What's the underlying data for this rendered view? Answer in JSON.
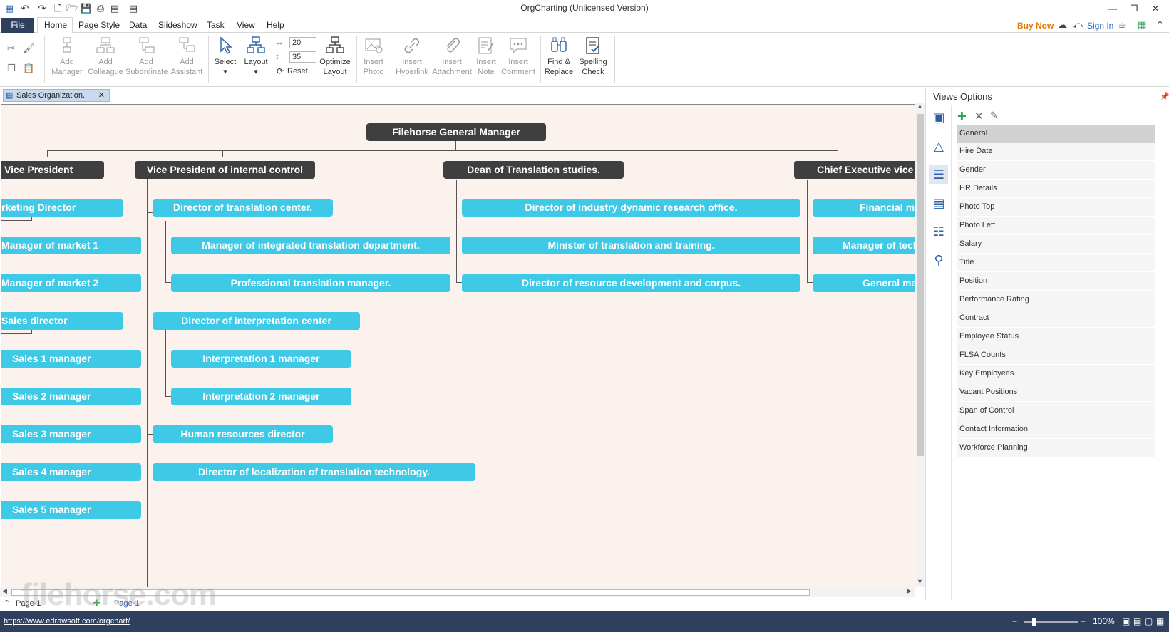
{
  "app": {
    "title": "OrgCharting (Unlicensed Version)"
  },
  "menu": {
    "file": "File",
    "items": [
      "Home",
      "Page Style",
      "Data",
      "Slideshow",
      "Task",
      "View",
      "Help"
    ],
    "buy_now": "Buy Now",
    "sign_in": "Sign In"
  },
  "ribbon": {
    "add_manager": [
      "Add",
      "Manager"
    ],
    "add_colleague": [
      "Add",
      "Colleague"
    ],
    "add_subordinate": [
      "Add",
      "Subordinate"
    ],
    "add_assistant": [
      "Add",
      "Assistant"
    ],
    "select": "Select",
    "layout": "Layout",
    "spacing_h": "20",
    "spacing_v": "35",
    "reset": "Reset",
    "optimize_layout": [
      "Optimize",
      "Layout"
    ],
    "insert_photo": [
      "Insert",
      "Photo"
    ],
    "insert_hyperlink": [
      "Insert",
      "Hyperlink"
    ],
    "insert_attachment": [
      "Insert",
      "Attachment"
    ],
    "insert_note": [
      "Insert",
      "Note"
    ],
    "insert_comment": [
      "Insert",
      "Comment"
    ],
    "find_replace": [
      "Find &",
      "Replace"
    ],
    "spelling_check": [
      "Spelling",
      "Check"
    ]
  },
  "document": {
    "tab_name": "Sales Organization..."
  },
  "chart": {
    "root": "Filehorse General Manager",
    "vp1": "Vice President",
    "vp1_children": [
      "rketing Director",
      "Manager of market 1",
      "Manager of market 2",
      "Sales director",
      "Sales 1 manager",
      "Sales 2 manager",
      "Sales 3 manager",
      "Sales 4 manager",
      "Sales 5 manager"
    ],
    "vp2": "Vice President of internal control",
    "vp2_children": {
      "translation_center": "Director of translation center.",
      "integrated": "Manager of integrated translation department.",
      "professional": "Professional translation manager.",
      "interpretation_center": "Director of interpretation center",
      "interp1": "Interpretation 1 manager",
      "interp2": "Interpretation 2 manager",
      "hr": "Human resources director",
      "localization": "Director of localization of translation technology."
    },
    "dean": "Dean of Translation studies.",
    "dean_children": [
      "Director of industry dynamic research office.",
      "Minister of translation and training.",
      "Director of resource development and corpus."
    ],
    "ceo": "Chief Executive vice",
    "ceo_children": [
      "Financial ma",
      "Manager of tech",
      "General ma"
    ]
  },
  "views_options": {
    "title": "Views Options",
    "items": [
      "General",
      "Hire Date",
      "Gender",
      "HR Details",
      "Photo Top",
      "Photo Left",
      "Salary",
      "Title",
      "Position",
      "Performance Rating",
      "Contract",
      "Employee Status",
      "FLSA Counts",
      "Key Employees",
      "Vacant Positions",
      "Span of Control",
      "Contact Information",
      "Workforce Planning"
    ],
    "selected": "General"
  },
  "pages": {
    "page_tab_1": "Page-1",
    "page_tab_2": "Page-1"
  },
  "status": {
    "url": "https://www.edrawsoft.com/orgchart/",
    "zoom": "100%"
  },
  "watermark": "filehorse.com"
}
